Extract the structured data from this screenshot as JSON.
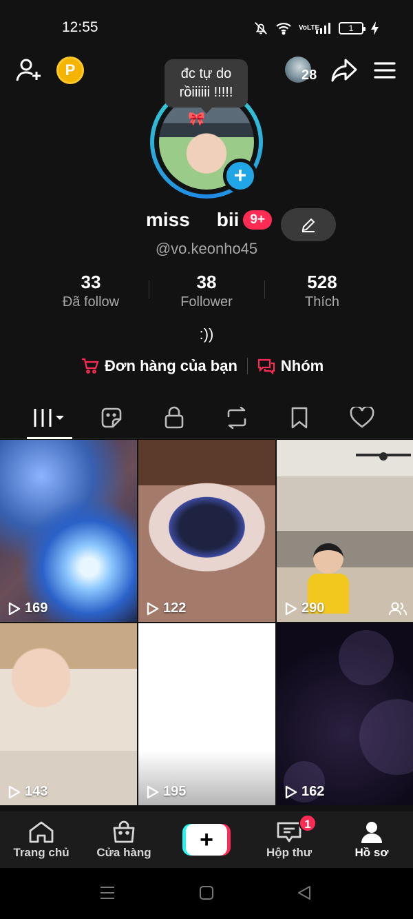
{
  "status_bar": {
    "time": "12:55",
    "battery": "1",
    "network": "VoLTE"
  },
  "header": {
    "coin_label": "P",
    "notification_count": "28",
    "bubble_text": "đc tự do rồiiiiii !!!!!"
  },
  "profile": {
    "name": "miss     bii",
    "notification_badge": "9+",
    "username": "@vo.keonho45",
    "bio": ":))"
  },
  "stats": [
    {
      "value": "33",
      "label": "Đã follow"
    },
    {
      "value": "38",
      "label": "Follower"
    },
    {
      "value": "528",
      "label": "Thích"
    }
  ],
  "links": {
    "orders": "Đơn hàng của bạn",
    "groups": "Nhóm"
  },
  "videos": [
    {
      "views": "169"
    },
    {
      "views": "122"
    },
    {
      "views": "290"
    },
    {
      "views": "143"
    },
    {
      "views": "195"
    },
    {
      "views": "162"
    }
  ],
  "bottom_nav": {
    "home": "Trang chủ",
    "shop": "Cửa hàng",
    "inbox": "Hộp thư",
    "inbox_badge": "1",
    "profile": "Hồ sơ"
  },
  "colors": {
    "accent": "#fe2c55",
    "cyan": "#25f4ee",
    "background": "#121212"
  }
}
